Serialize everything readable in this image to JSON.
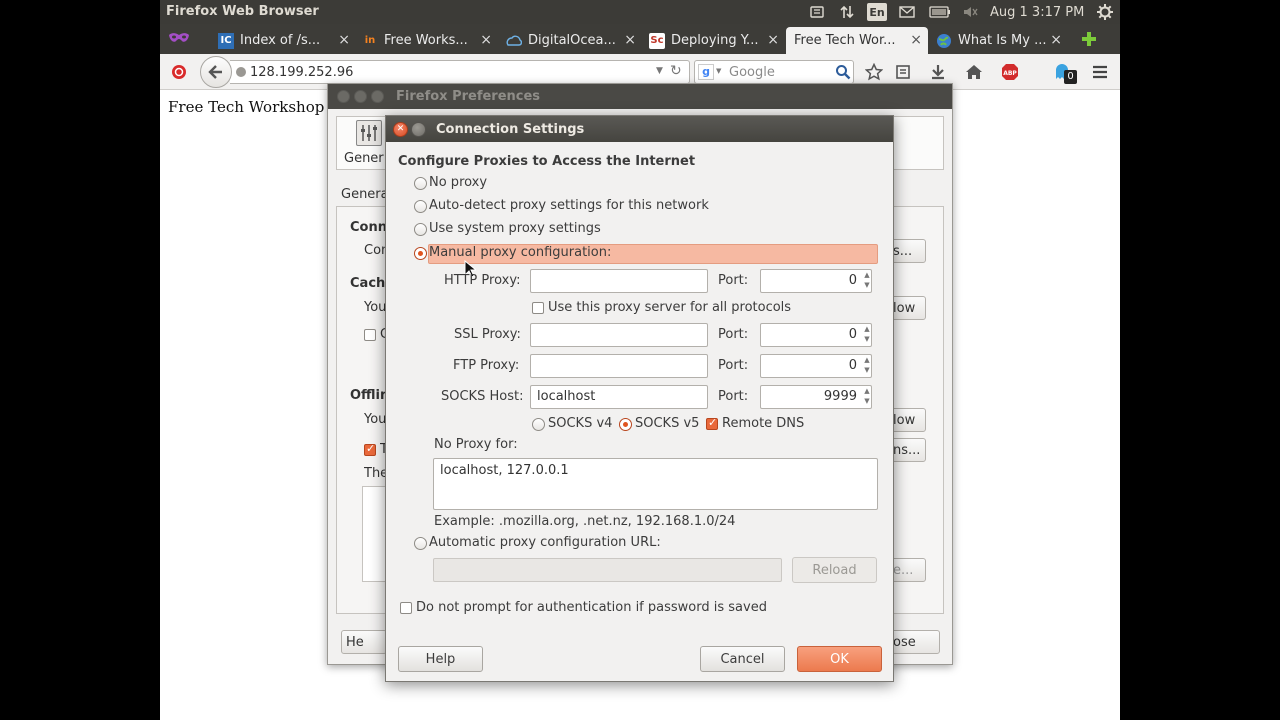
{
  "topbar": {
    "window_title": "Firefox Web Browser",
    "keyboard_layout": "En",
    "clock": "Aug  1  3:17 PM",
    "icons": [
      "dropbox-icon",
      "network-arrows-icon",
      "keyboard-icon",
      "mail-icon",
      "battery-icon",
      "volume-icon",
      "gear-icon"
    ]
  },
  "tabs": [
    {
      "label": "Index of /s...",
      "favicon": "ict-favicon",
      "active": false
    },
    {
      "label": "Free Works...",
      "favicon": "in-favicon",
      "active": false
    },
    {
      "label": "DigitalOcea...",
      "favicon": "digitalocean-favicon",
      "active": false
    },
    {
      "label": "Deploying Y...",
      "favicon": "sc-favicon",
      "active": false
    },
    {
      "label": "Free Tech Wor...",
      "favicon": "none",
      "active": true
    },
    {
      "label": "What Is My ...",
      "favicon": "globe-favicon",
      "active": false
    }
  ],
  "navbar": {
    "url": "128.199.252.96",
    "search_placeholder": "Google",
    "adblock_count": "0"
  },
  "page": {
    "text": "Free Tech Workshop"
  },
  "prefs_window": {
    "title": "Firefox Preferences",
    "general_tab": "Genera",
    "advanced_subtab": "Genera",
    "connection_heading": "Conn",
    "connection_text": "Con",
    "settings_button": "s...",
    "cache_heading": "Cache",
    "cache_text": "You",
    "cache_check": "C",
    "clear_now_button": "low",
    "offline_heading": "Offlin",
    "offline_text": "You",
    "clear_now_button2": "low",
    "tell_check": "T",
    "exceptions_button": "ns...",
    "the_text": "The",
    "remove_button": "e...",
    "help_button": "He",
    "close_button": "ose"
  },
  "connection_dialog": {
    "title": "Connection Settings",
    "heading": "Configure Proxies to Access the Internet",
    "options": {
      "no_proxy": "No proxy",
      "auto_detect": "Auto-detect proxy settings for this network",
      "system": "Use system proxy settings",
      "manual": "Manual proxy configuration:"
    },
    "http_proxy_label": "HTTP Proxy:",
    "http_proxy_value": "",
    "http_port": "0",
    "share_label": "Use this proxy server for all protocols",
    "ssl_proxy_label": "SSL Proxy:",
    "ssl_proxy_value": "",
    "ssl_port": "0",
    "ftp_proxy_label": "FTP Proxy:",
    "ftp_proxy_value": "",
    "ftp_port": "0",
    "socks_host_label": "SOCKS Host:",
    "socks_host_value": "localhost",
    "socks_port": "9999",
    "port_label": "Port:",
    "socks_v4": "SOCKS v4",
    "socks_v5": "SOCKS v5",
    "remote_dns": "Remote DNS",
    "no_proxy_for_label": "No Proxy for:",
    "no_proxy_for_value": "localhost, 127.0.0.1",
    "example": "Example: .mozilla.org, .net.nz, 192.168.1.0/24",
    "auto_url_label": "Automatic proxy configuration URL:",
    "auto_url_value": "",
    "reload_button": "Reload",
    "no_auth_prompt": "Do not prompt for authentication if password is saved",
    "help_button": "Help",
    "cancel_button": "Cancel",
    "ok_button": "OK",
    "selected_proxy_mode": "manual",
    "selected_socks_version": "v5",
    "remote_dns_checked": true,
    "share_checked": false,
    "no_auth_prompt_checked": false
  },
  "colors": {
    "accent": "#e9693b",
    "highlight": "#f6b9a2",
    "panel": "#3c3b37"
  }
}
